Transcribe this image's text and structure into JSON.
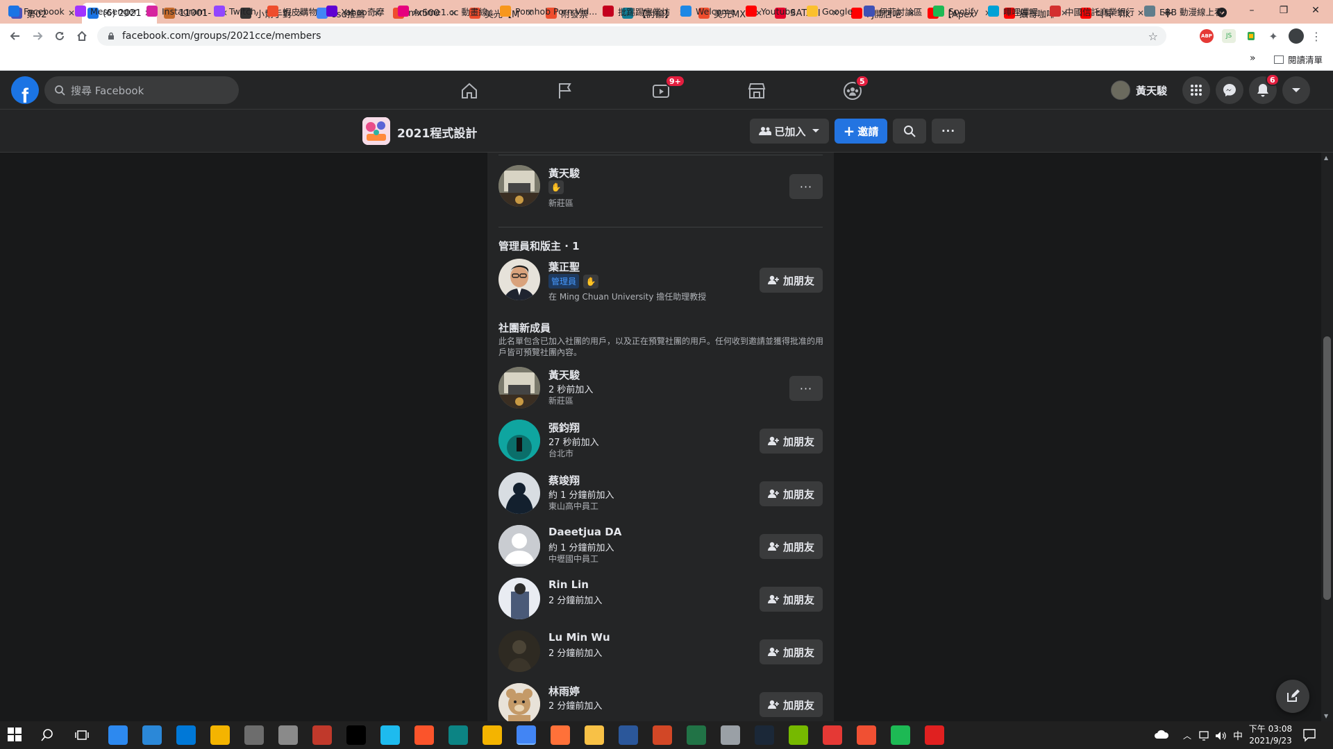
{
  "browser": {
    "tabs": [
      {
        "title": "第02",
        "icon_color": "#4b53bc",
        "icon": "teams-icon"
      },
      {
        "title": "(6) 2021",
        "icon_color": "#1b74e4",
        "icon": "facebook-icon",
        "active": true
      },
      {
        "title": "11001-",
        "icon_color": "#c46a2c",
        "icon": "moodle-icon"
      },
      {
        "title": "小幫手對",
        "icon_color": "#333333",
        "icon": "github-icon"
      },
      {
        "title": "ssd推薦",
        "icon_color": "#4285f4",
        "icon": "google-icon"
      },
      {
        "title": "mx500",
        "icon_color": "#ee4d2d",
        "icon": "shopee-icon"
      },
      {
        "title": "美光【M",
        "icon_color": "#ee4d2d",
        "icon": "shopee-icon"
      },
      {
        "title": "附發票",
        "icon_color": "#ee4d2d",
        "icon": "shopee-icon"
      },
      {
        "title": "【討論】",
        "icon_color": "#117e96",
        "icon": "bahamut-icon"
      },
      {
        "title": "美光MX",
        "icon_color": "#ee4d2d",
        "icon": "shopee-icon"
      },
      {
        "title": "SATAIII",
        "icon_color": "#e4002b",
        "icon": "24h-icon"
      },
      {
        "title": "FJ開店吧",
        "icon_color": "#ff0000",
        "icon": "youtube-icon"
      },
      {
        "title": "【Apex",
        "icon_color": "#ff0000",
        "icon": "youtube-icon"
      },
      {
        "title": "攝哥咖啡",
        "icon_color": "#ff0000",
        "icon": "youtube-icon"
      },
      {
        "title": "틱톡 'Tik",
        "icon_color": "#ff0000",
        "icon": "youtube-icon"
      }
    ],
    "new_tab": "+",
    "window_controls": {
      "minimize": "–",
      "restore": "❐",
      "close": "✕"
    },
    "url": "facebook.com/groups/2021cce/members",
    "bookmarks": [
      {
        "label": "Facebook",
        "color": "#1b74e4"
      },
      {
        "label": "Messenger",
        "color": "#a033ff"
      },
      {
        "label": "Instagram",
        "color": "#d6249f"
      },
      {
        "label": "Twitch",
        "color": "#9146ff"
      },
      {
        "label": "蝦皮購物",
        "color": "#ee4d2d"
      },
      {
        "label": "Yahoo奇摩",
        "color": "#6001d2"
      },
      {
        "label": "Anime1.cc 動畫線...",
        "color": "#e6007e"
      },
      {
        "label": "Pornhob Porn Vid...",
        "color": "#f7971d"
      },
      {
        "label": "批踢踢實業坊",
        "color": "#c4001d"
      },
      {
        "label": "Welcome",
        "color": "#1e88e5"
      },
      {
        "label": "Youtube",
        "color": "#ff0000"
      },
      {
        "label": "Google",
        "color": "#fbc02d"
      },
      {
        "label": "伊莉討論區",
        "color": "#3f51b5"
      },
      {
        "label": "Spotify",
        "color": "#1db954"
      },
      {
        "label": "嗶哩嗶哩",
        "color": "#00a1d6"
      },
      {
        "label": "中國信託商業銀行",
        "color": "#d32f2f"
      },
      {
        "label": "EBB 動漫線上看",
        "color": "#607d8b"
      }
    ],
    "bookmarks_more": "»",
    "reading_list": "閱讀清單"
  },
  "facebook": {
    "search_placeholder": "搜尋 Facebook",
    "watch_badge": "9+",
    "groups_badge": "5",
    "notifications_badge": "6",
    "profile_name": "黃天駿"
  },
  "group": {
    "name": "2021程式設計",
    "joined_label": "已加入",
    "invite_label": "邀請"
  },
  "members": {
    "me": {
      "name": "黃天駿",
      "location": "新莊區"
    },
    "admins_title": "管理員和版主 · 1",
    "admin": {
      "name": "葉正聖",
      "role_badge": "管理員",
      "detail": "在 Ming Chuan University 擔任助理教授",
      "action": "加朋友"
    },
    "new_members_title": "社團新成員",
    "new_members_desc": "此名單包含已加入社團的用戶，以及正在預覽社團的用戶。任何收到邀請並獲得批准的用戶皆可預覽社團內容。",
    "list": [
      {
        "name": "黃天駿",
        "joined": "2 秒前加入",
        "detail": "新莊區",
        "action": "more",
        "avatar_color": "#6b6a5e"
      },
      {
        "name": "張鈞翔",
        "joined": "27 秒前加入",
        "detail": "台北市",
        "action": "加朋友",
        "avatar_color": "#0fa5a0"
      },
      {
        "name": "蔡竣翔",
        "joined": "約 1 分鐘前加入",
        "detail": "東山高中員工",
        "action": "加朋友",
        "avatar_color": "#1d3b4f"
      },
      {
        "name": "Daeetjua DA",
        "joined": "約 1 分鐘前加入",
        "detail": "中壢國中員工",
        "action": "加朋友",
        "avatar_color": "#c9ccd1"
      },
      {
        "name": "Rin Lin",
        "joined": "2 分鐘前加入",
        "detail": "",
        "action": "加朋友",
        "avatar_color": "#4a5a78"
      },
      {
        "name": "Lu Min Wu",
        "joined": "2 分鐘前加入",
        "detail": "",
        "action": "加朋友",
        "avatar_color": "#2e2a22"
      },
      {
        "name": "林雨婷",
        "joined": "2 分鐘前加入",
        "detail": "",
        "action": "加朋友",
        "avatar_color": "#c8a880"
      }
    ]
  },
  "taskbar": {
    "time": "下午 03:08",
    "date": "2021/9/23",
    "ime": "中",
    "apps": [
      {
        "name": "file-explorer-icon",
        "color": "#2d89ef"
      },
      {
        "name": "desktop-icon",
        "color": "#2b88d8"
      },
      {
        "name": "store-icon",
        "color": "#0078d7"
      },
      {
        "name": "weather-icon",
        "color": "#f4b400"
      },
      {
        "name": "settings-icon",
        "color": "#6d6d6d"
      },
      {
        "name": "network-icon",
        "color": "#8a8a8a"
      },
      {
        "name": "calendar-icon",
        "color": "#c0392b"
      },
      {
        "name": "terminal-icon",
        "color": "#000000"
      },
      {
        "name": "ie-icon",
        "color": "#1ebbee"
      },
      {
        "name": "brave-icon",
        "color": "#fb542b"
      },
      {
        "name": "edge-icon",
        "color": "#0c8484"
      },
      {
        "name": "chrome-canary-icon",
        "color": "#f4b400"
      },
      {
        "name": "chrome-icon",
        "color": "#4285f4"
      },
      {
        "name": "firefox-icon",
        "color": "#ff7139"
      },
      {
        "name": "folder-icon",
        "color": "#f8c146"
      },
      {
        "name": "word-icon",
        "color": "#2b579a"
      },
      {
        "name": "powerpoint-icon",
        "color": "#d24726"
      },
      {
        "name": "excel-icon",
        "color": "#217346"
      },
      {
        "name": "vpn-icon",
        "color": "#9aa0a6"
      },
      {
        "name": "steam-icon",
        "color": "#1b2838"
      },
      {
        "name": "nvidia-icon",
        "color": "#76b900"
      },
      {
        "name": "cursor-app-icon",
        "color": "#e53935"
      },
      {
        "name": "git-icon",
        "color": "#f05033"
      },
      {
        "name": "spotify-icon",
        "color": "#1db954"
      },
      {
        "name": "acrobat-icon",
        "color": "#e02020"
      }
    ]
  }
}
